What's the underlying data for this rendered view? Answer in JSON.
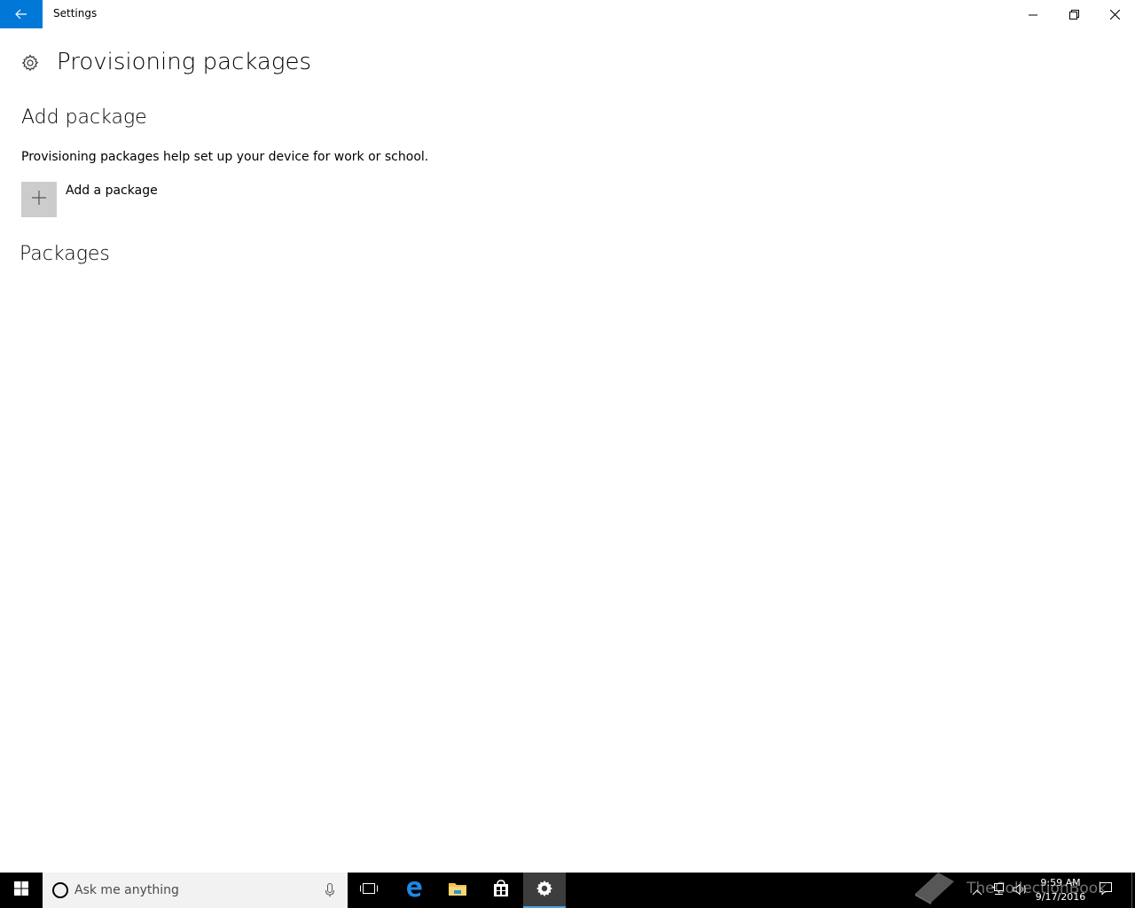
{
  "window": {
    "title": "Settings"
  },
  "page": {
    "title": "Provisioning packages"
  },
  "add_section": {
    "title": "Add package",
    "description": "Provisioning packages help set up your device for work or school.",
    "add_label": "Add a package"
  },
  "packages_section": {
    "title": "Packages"
  },
  "taskbar": {
    "search_placeholder": "Ask me anything",
    "clock_time": "9:59 AM",
    "clock_date": "9/17/2016"
  },
  "watermark": {
    "text": "TheCollectionBook"
  },
  "colors": {
    "accent": "#0078d7",
    "add_tile": "#cccccc",
    "taskbar": "#000000"
  },
  "icons": [
    "back-arrow-icon",
    "minimize-icon",
    "restore-icon",
    "close-icon",
    "gear-icon",
    "plus-icon",
    "windows-logo-icon",
    "cortana-ring-icon",
    "microphone-icon",
    "task-view-icon",
    "edge-icon",
    "file-explorer-icon",
    "store-icon",
    "settings-gear-icon",
    "chevron-up-icon",
    "network-icon",
    "volume-icon",
    "action-center-icon",
    "book-icon"
  ]
}
